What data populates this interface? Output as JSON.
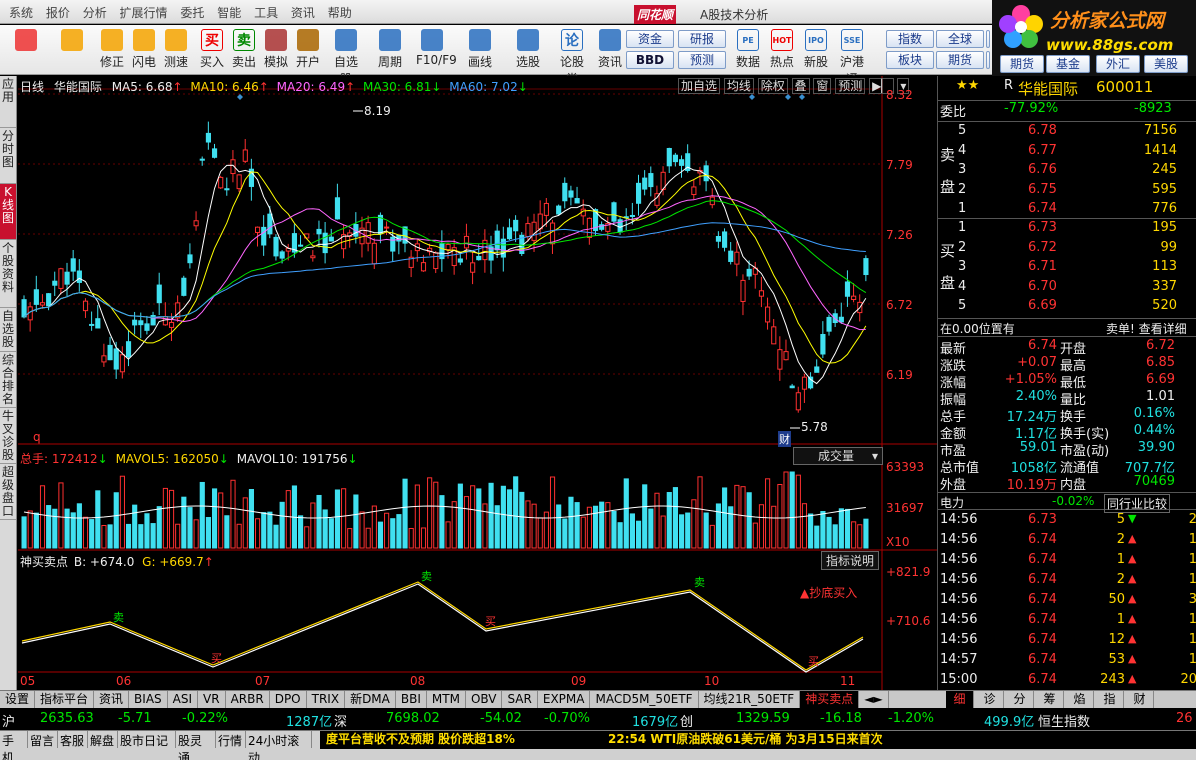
{
  "menu": [
    "系统",
    "报价",
    "分析",
    "扩展行情",
    "委托",
    "智能",
    "工具",
    "资讯",
    "帮助"
  ],
  "app_logo": "同花顺",
  "app_title": "A股技术分析",
  "brand": {
    "line1": "分析家公式网",
    "line2": "www.88gs.com"
  },
  "toolbar": [
    {
      "label": "",
      "icon": "windows-icon",
      "color": "#e33"
    },
    {
      "label": "",
      "icon": "back-arrow-icon",
      "color": "#f5a400"
    },
    {
      "label": "修正",
      "icon": "up-down-arrow-icon",
      "color": "#f5a400"
    },
    {
      "label": "闪电",
      "icon": "lightning-icon",
      "color": "#f5a400"
    },
    {
      "label": "测速",
      "icon": "clock-icon",
      "color": "#f5a400"
    },
    {
      "label": "买入",
      "icon": "buy-icon",
      "glyph": "买",
      "color": "#e00"
    },
    {
      "label": "卖出",
      "icon": "sell-icon",
      "glyph": "卖",
      "color": "#080"
    },
    {
      "label": "模拟",
      "icon": "hammer-icon",
      "color": "#a33"
    },
    {
      "label": "开户",
      "icon": "lock-icon",
      "color": "#a60"
    },
    {
      "label": "自选股",
      "icon": "star-folder-icon",
      "color": "#2a6fc0"
    },
    {
      "label": "周期",
      "icon": "clock-period-icon",
      "color": "#2a6fc0"
    },
    {
      "label": "F10/F9",
      "icon": "f10-icon",
      "color": "#2a6fc0"
    },
    {
      "label": "画线",
      "icon": "pen-icon",
      "color": "#2a6fc0"
    },
    {
      "label": "选股",
      "icon": "screen-icon",
      "color": "#2a6fc0"
    },
    {
      "label": "论股堂",
      "icon": "discuss-icon",
      "glyph": "论",
      "color": "#2a6fc0"
    },
    {
      "label": "资讯",
      "icon": "news-icon",
      "color": "#2a6fc0"
    }
  ],
  "toolbar_buttons": [
    [
      "资金",
      "研报"
    ],
    [
      "BBD",
      "预测"
    ]
  ],
  "toolbar_right": [
    {
      "label": "数据",
      "icon": "pe-icon",
      "glyph": "PE",
      "color": "#2a6fc0"
    },
    {
      "label": "热点",
      "icon": "hot-icon",
      "glyph": "HOT",
      "color": "#e00"
    },
    {
      "label": "新股",
      "icon": "ipo-icon",
      "glyph": "IPO",
      "color": "#2a6fc0"
    },
    {
      "label": "沪港通",
      "icon": "hk-icon",
      "glyph": "SSE",
      "color": "#2a6fc0"
    }
  ],
  "quick_buttons": [
    [
      "指数",
      "全球",
      "个股"
    ],
    [
      "个股",
      "板块",
      "期货"
    ]
  ],
  "quick_buttons2": [
    "指数",
    "全球",
    "个股",
    "板块",
    "期货",
    "基金",
    "外汇",
    "美股"
  ],
  "sidebar": [
    "应用",
    "分时图",
    "K线图",
    "个股资料",
    "自选股",
    "综合排名",
    "牛叉诊股",
    "超级盘口"
  ],
  "sidebar_active": 2,
  "chart_header": {
    "period": "日线",
    "name": "华能国际",
    "ma5": "MA5: 6.68",
    "ma10": "MA10: 6.46",
    "ma20": "MA20: 6.49",
    "ma30": "MA30: 6.81",
    "ma60": "MA60: 7.02",
    "arrows": [
      "↑",
      "↑",
      "↑",
      "↓",
      "↓"
    ],
    "buttons": [
      "加自选",
      "均线",
      "除权",
      "叠",
      "窗",
      "预测"
    ]
  },
  "price_axis": [
    "8.32",
    "7.79",
    "7.26",
    "6.72",
    "6.19"
  ],
  "price_high_label": "8.19",
  "price_low_label": "5.78",
  "finance_marker": "财",
  "q_marker": "q",
  "volume_header": {
    "label": "总手: 172412",
    "mavol5": "MAVOL5: 162050",
    "mavol10": "MAVOL10: 191756",
    "arrows": [
      "↓",
      "↓",
      "↓"
    ]
  },
  "volume_dropdown": "成交量",
  "volume_axis": [
    "63393",
    "31697"
  ],
  "volume_unit": "X10",
  "indicator_header": {
    "name": "神买卖点",
    "b": "B: +674.0",
    "g": "G: +669.7",
    "arrow": "↑"
  },
  "indicator_button": "指标说明",
  "indicator_axis": [
    "+821.9",
    "+710.6"
  ],
  "indicator_note": "▲抄底买入",
  "signals": [
    {
      "text": "卖",
      "type": "sell"
    },
    {
      "text": "买",
      "type": "buy"
    },
    {
      "text": "卖",
      "type": "sell"
    },
    {
      "text": "买",
      "type": "buy"
    },
    {
      "text": "卖",
      "type": "sell"
    },
    {
      "text": "买",
      "type": "buy"
    }
  ],
  "months": [
    "05",
    "06",
    "07",
    "08",
    "09",
    "10",
    "11"
  ],
  "quote": {
    "stars": "★★",
    "r_flag": "R",
    "name": "华能国际",
    "code": "600011",
    "weibi_label": "委比",
    "weibi": "-77.92%",
    "weicha": "-8923",
    "sell_label": [
      "卖",
      "盘"
    ],
    "buy_label": [
      "买",
      "盘"
    ],
    "sells": [
      {
        "lvl": "5",
        "price": "6.78",
        "vol": "7156"
      },
      {
        "lvl": "4",
        "price": "6.77",
        "vol": "1414"
      },
      {
        "lvl": "3",
        "price": "6.76",
        "vol": "245"
      },
      {
        "lvl": "2",
        "price": "6.75",
        "vol": "595"
      },
      {
        "lvl": "1",
        "price": "6.74",
        "vol": "776"
      }
    ],
    "buys": [
      {
        "lvl": "1",
        "price": "6.73",
        "vol": "195"
      },
      {
        "lvl": "2",
        "price": "6.72",
        "vol": "99"
      },
      {
        "lvl": "3",
        "price": "6.71",
        "vol": "113"
      },
      {
        "lvl": "4",
        "price": "6.70",
        "vol": "337"
      },
      {
        "lvl": "5",
        "price": "6.69",
        "vol": "520"
      }
    ],
    "pos_note": "在0.00位置有",
    "pos_link": "卖单! 查看详细",
    "stats": [
      [
        "最新",
        "6.74",
        "开盘",
        "6.72"
      ],
      [
        "涨跌",
        "+0.07",
        "最高",
        "6.85"
      ],
      [
        "涨幅",
        "+1.05%",
        "最低",
        "6.69"
      ],
      [
        "振幅",
        "2.40%",
        "量比",
        "1.01"
      ],
      [
        "总手",
        "17.24万",
        "换手",
        "0.16%"
      ],
      [
        "金额",
        "1.17亿",
        "换手(实)",
        "0.44%"
      ],
      [
        "市盈",
        "59.01",
        "市盈(动)",
        "39.90"
      ],
      [
        "总市值",
        "1058亿",
        "流通值",
        "707.7亿"
      ],
      [
        "外盘",
        "10.19万",
        "内盘",
        "70469"
      ]
    ],
    "sector": "电力",
    "sector_chg": "-0.02%",
    "compare_btn": "同行业比较",
    "ticks": [
      [
        "14:56",
        "6.73",
        "5",
        "down",
        "2"
      ],
      [
        "14:56",
        "6.74",
        "2",
        "up",
        "1"
      ],
      [
        "14:56",
        "6.74",
        "1",
        "up",
        "1"
      ],
      [
        "14:56",
        "6.74",
        "2",
        "up",
        "1"
      ],
      [
        "14:56",
        "6.74",
        "50",
        "up",
        "3"
      ],
      [
        "14:56",
        "6.74",
        "1",
        "up",
        "1"
      ],
      [
        "14:56",
        "6.74",
        "12",
        "up",
        "1"
      ],
      [
        "14:57",
        "6.74",
        "53",
        "up",
        "1"
      ],
      [
        "15:00",
        "6.74",
        "243",
        "up",
        "20"
      ]
    ],
    "tabs": [
      "细",
      "诊",
      "分",
      "筹",
      "焰",
      "指",
      "财"
    ]
  },
  "bottom_tabs": [
    "设置",
    "指标平台",
    "资讯",
    "BIAS",
    "ASI",
    "VR",
    "ARBR",
    "DPO",
    "TRIX",
    "新DMA",
    "BBI",
    "MTM",
    "OBV",
    "SAR",
    "EXPMA",
    "MACD5M_50ETF",
    "均线21R_50ETF",
    "神买卖点"
  ],
  "bottom_tab_active": 17,
  "ticker": {
    "sh_label": "沪",
    "sh_val": "2635.63",
    "sh_chg": "-5.71",
    "sh_pct": "-0.22%",
    "sh_amt": "1287亿",
    "sz_label": "深",
    "sz_val": "7698.02",
    "sz_chg": "-54.02",
    "sz_pct": "-0.70%",
    "sz_amt": "1679亿",
    "cy_label": "创",
    "cy_val": "1329.59",
    "cy_chg": "-16.18",
    "cy_pct": "-1.20%",
    "hk_amt": "499.9亿",
    "hk_label": "恒生指数",
    "hk_tail": "26"
  },
  "status_buttons": [
    "手机",
    "留言",
    "客服",
    "解盘",
    "股市日记",
    "股灵通",
    "行情",
    "24小时滚动"
  ],
  "news_left": "度平台营收不及预期 股价跌超18%",
  "news_right": "22:54 WTI原油跌破61美元/桶 为3月15日来首次",
  "chart_data": {
    "type": "candlestick",
    "symbol": "600011",
    "price_range": [
      5.78,
      8.32
    ],
    "high": 8.19,
    "low": 5.78,
    "volume_max": 63393,
    "x_months": [
      "05",
      "06",
      "07",
      "08",
      "09",
      "10",
      "11"
    ]
  }
}
